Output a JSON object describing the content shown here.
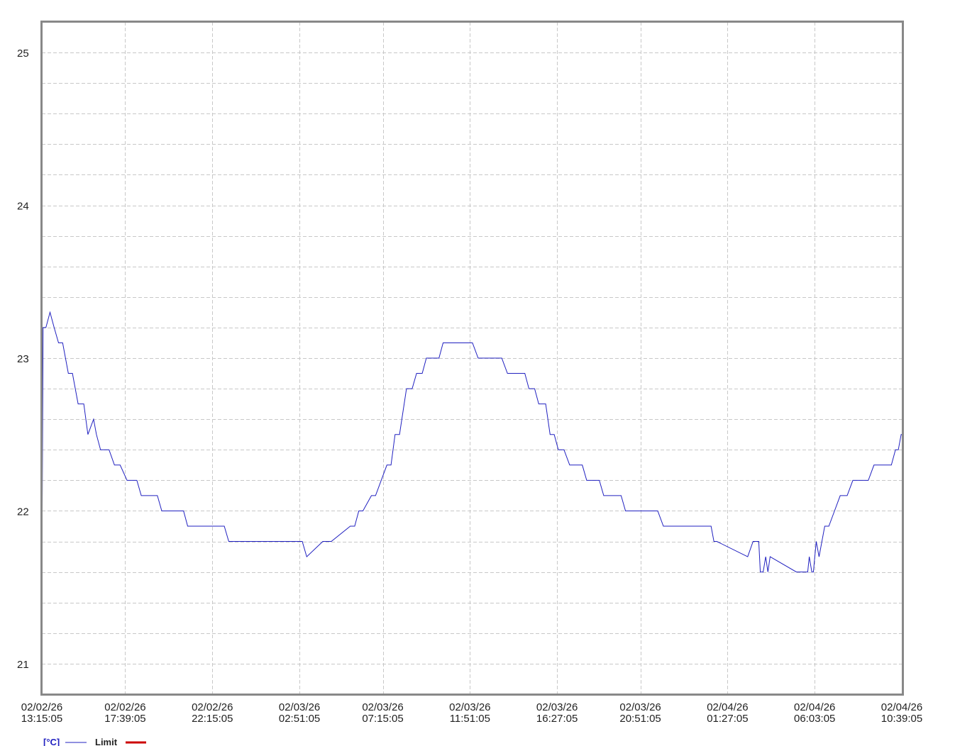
{
  "chart_data": {
    "type": "line",
    "title": "",
    "xlabel": "",
    "ylabel": "",
    "ylim": [
      20.8,
      25.2
    ],
    "y_ticks": [
      21,
      22,
      23,
      24,
      25
    ],
    "y_tick_labels": [
      "21",
      "22",
      "23",
      "24",
      "25"
    ],
    "x_ticks": [
      {
        "date": "02/02/26",
        "time": "13:15:05"
      },
      {
        "date": "02/02/26",
        "time": "17:39:05"
      },
      {
        "date": "02/02/26",
        "time": "22:15:05"
      },
      {
        "date": "02/03/26",
        "time": "02:51:05"
      },
      {
        "date": "02/03/26",
        "time": "07:15:05"
      },
      {
        "date": "02/03/26",
        "time": "11:51:05"
      },
      {
        "date": "02/03/26",
        "time": "16:27:05"
      },
      {
        "date": "02/03/26",
        "time": "20:51:05"
      },
      {
        "date": "02/04/26",
        "time": "01:27:05"
      },
      {
        "date": "02/04/26",
        "time": "06:03:05"
      },
      {
        "date": "02/04/26",
        "time": "10:39:05"
      }
    ],
    "grid": true,
    "legend_position": "bottom-left",
    "series": [
      {
        "name": "[°C]",
        "color": "#2020c0",
        "x": [
          "2026-02-02 13:15",
          "2026-02-02 13:19",
          "2026-02-02 13:28",
          "2026-02-02 13:41",
          "2026-02-02 13:54",
          "2026-02-02 14:08",
          "2026-02-02 14:21",
          "2026-02-02 14:39",
          "2026-02-02 14:52",
          "2026-02-02 15:10",
          "2026-02-02 15:28",
          "2026-02-02 15:41",
          "2026-02-02 15:59",
          "2026-02-02 16:08",
          "2026-02-02 16:21",
          "2026-02-02 16:35",
          "2026-02-02 16:48",
          "2026-02-02 17:05",
          "2026-02-02 17:14",
          "2026-02-02 17:23",
          "2026-02-02 17:45",
          "2026-02-02 18:16",
          "2026-02-02 18:30",
          "2026-02-02 19:21",
          "2026-02-02 19:35",
          "2026-02-02 20:44",
          "2026-02-02 20:57",
          "2026-02-02 22:53",
          "2026-02-02 23:07",
          "2026-02-03 03:00",
          "2026-02-03 03:14",
          "2026-02-03 04:05",
          "2026-02-03 04:18",
          "2026-02-03 04:32",
          "2026-02-03 05:32",
          "2026-02-03 05:46",
          "2026-02-03 05:59",
          "2026-02-03 06:12",
          "2026-02-03 06:39",
          "2026-02-03 06:52",
          "2026-02-03 07:28",
          "2026-02-03 07:41",
          "2026-02-03 07:54",
          "2026-02-03 08:08",
          "2026-02-03 08:30",
          "2026-02-03 08:48",
          "2026-02-03 09:02",
          "2026-02-03 09:20",
          "2026-02-03 09:33",
          "2026-02-03 10:13",
          "2026-02-03 10:26",
          "2026-02-03 11:59",
          "2026-02-03 12:17",
          "2026-02-03 13:32",
          "2026-02-03 13:50",
          "2026-02-03 14:45",
          "2026-02-03 14:58",
          "2026-02-03 15:16",
          "2026-02-03 15:29",
          "2026-02-03 15:51",
          "2026-02-03 16:05",
          "2026-02-03 16:18",
          "2026-02-03 16:31",
          "2026-02-03 16:49",
          "2026-02-03 17:07",
          "2026-02-03 17:47",
          "2026-02-03 18:01",
          "2026-02-03 18:41",
          "2026-02-03 18:55",
          "2026-02-03 19:50",
          "2026-02-03 20:04",
          "2026-02-03 21:46",
          "2026-02-03 22:04",
          "2026-02-04 00:35",
          "2026-02-04 00:44",
          "2026-02-04 00:53",
          "2026-02-04 02:31",
          "2026-02-04 02:48",
          "2026-02-04 03:06",
          "2026-02-04 03:11",
          "2026-02-04 03:20",
          "2026-02-04 03:28",
          "2026-02-04 03:35",
          "2026-02-04 03:42",
          "2026-02-04 05:05",
          "2026-02-04 05:14",
          "2026-02-04 05:23",
          "2026-02-04 05:41",
          "2026-02-04 05:46",
          "2026-02-04 05:54",
          "2026-02-04 05:59",
          "2026-02-04 06:08",
          "2026-02-04 06:17",
          "2026-02-04 06:35",
          "2026-02-04 06:48",
          "2026-02-04 07:06",
          "2026-02-04 07:24",
          "2026-02-04 07:46",
          "2026-02-04 08:04",
          "2026-02-04 08:53",
          "2026-02-04 09:11",
          "2026-02-04 10:06",
          "2026-02-04 10:19",
          "2026-02-04 10:28",
          "2026-02-04 10:37",
          "2026-02-04 10:39"
        ],
        "values": [
          21.5,
          23.2,
          23.2,
          23.3,
          23.2,
          23.1,
          23.1,
          22.9,
          22.9,
          22.7,
          22.7,
          22.5,
          22.6,
          22.5,
          22.4,
          22.4,
          22.4,
          22.3,
          22.3,
          22.3,
          22.2,
          22.2,
          22.1,
          22.1,
          22.0,
          22.0,
          21.9,
          21.9,
          21.8,
          21.8,
          21.7,
          21.8,
          21.8,
          21.8,
          21.9,
          21.9,
          22.0,
          22.0,
          22.1,
          22.1,
          22.3,
          22.3,
          22.5,
          22.5,
          22.8,
          22.8,
          22.9,
          22.9,
          23.0,
          23.0,
          23.1,
          23.1,
          23.0,
          23.0,
          22.9,
          22.9,
          22.8,
          22.8,
          22.7,
          22.7,
          22.5,
          22.5,
          22.4,
          22.4,
          22.3,
          22.3,
          22.2,
          22.2,
          22.1,
          22.1,
          22.0,
          22.0,
          21.9,
          21.9,
          21.8,
          21.8,
          21.7,
          21.8,
          21.8,
          21.6,
          21.6,
          21.7,
          21.6,
          21.7,
          21.6,
          21.6,
          21.6,
          21.6,
          21.7,
          21.6,
          21.6,
          21.8,
          21.7,
          21.9,
          21.9,
          22.0,
          22.1,
          22.1,
          22.2,
          22.2,
          22.3,
          22.3,
          22.4,
          22.4,
          22.5,
          22.5
        ]
      },
      {
        "name": "Limit",
        "color": "#cc0000",
        "values": []
      }
    ]
  }
}
